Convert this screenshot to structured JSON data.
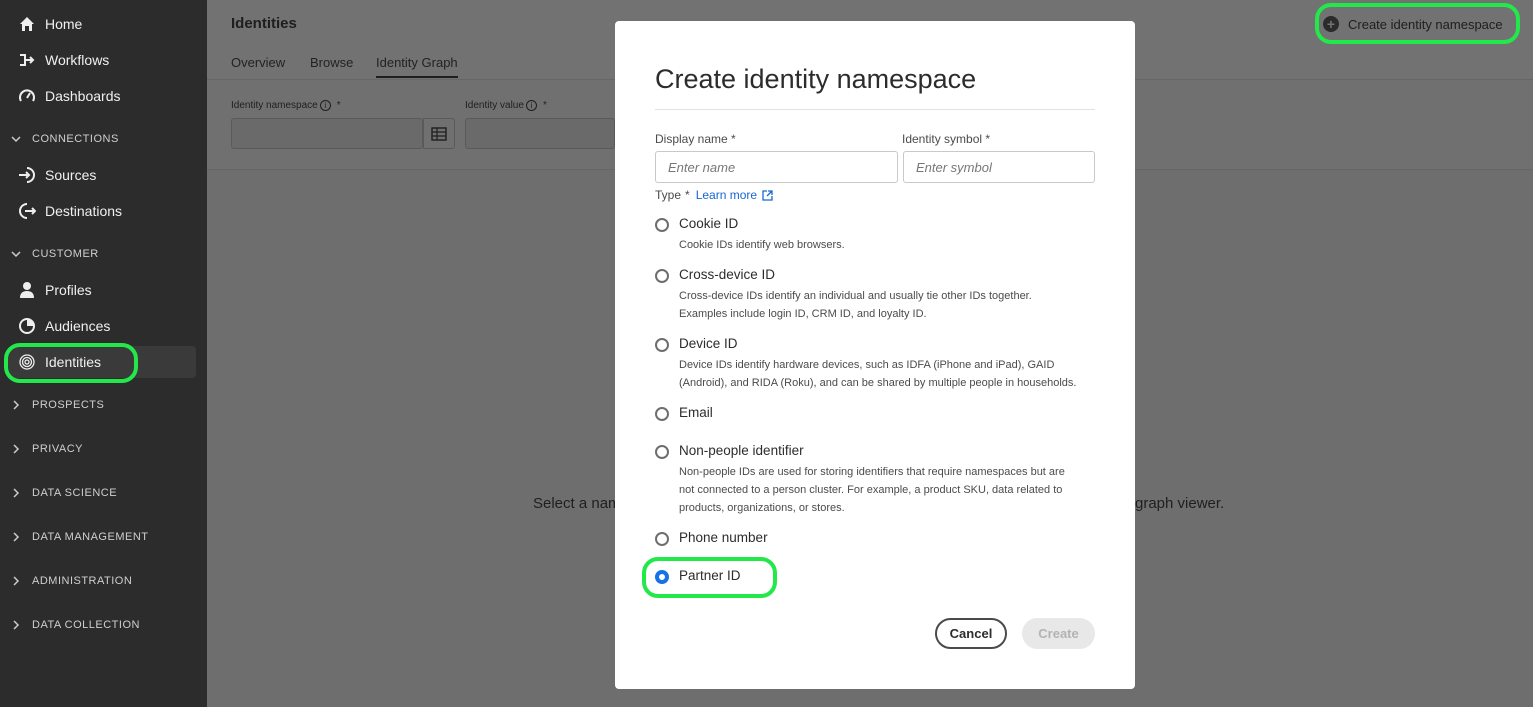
{
  "sidebar": {
    "items": [
      {
        "label": "Home",
        "icon": "home-icon"
      },
      {
        "label": "Workflows",
        "icon": "workflow-icon"
      },
      {
        "label": "Dashboards",
        "icon": "dashboard-icon"
      },
      {
        "label": "Sources",
        "icon": "source-icon"
      },
      {
        "label": "Destinations",
        "icon": "destination-icon"
      },
      {
        "label": "Profiles",
        "icon": "user-icon"
      },
      {
        "label": "Audiences",
        "icon": "audience-icon"
      },
      {
        "label": "Identities",
        "icon": "fingerprint-icon",
        "active": true
      }
    ],
    "sections": [
      "CONNECTIONS",
      "CUSTOMER",
      "PROSPECTS",
      "PRIVACY",
      "DATA SCIENCE",
      "DATA MANAGEMENT",
      "ADMINISTRATION",
      "DATA COLLECTION"
    ]
  },
  "header": {
    "title": "Identities",
    "tabs": [
      "Overview",
      "Browse",
      "Identity Graph"
    ],
    "active_tab": "Identity Graph",
    "create_button": "Create identity namespace"
  },
  "filters": {
    "namespace_label": "Identity namespace",
    "value_label": "Identity value",
    "required_mark": "*",
    "info_glyph": "i"
  },
  "main": {
    "empty_left": "Select a nam",
    "empty_right": "graph viewer."
  },
  "modal": {
    "title": "Create identity namespace",
    "display_name_label": "Display name",
    "display_name_placeholder": "Enter name",
    "identity_symbol_label": "Identity symbol",
    "identity_symbol_placeholder": "Enter symbol",
    "type_label": "Type",
    "required_mark": "*",
    "learn_more": "Learn more",
    "options": [
      {
        "title": "Cookie ID",
        "lines": [
          "Cookie IDs identify web browsers."
        ]
      },
      {
        "title": "Cross-device ID",
        "lines": [
          "Cross-device IDs identify an individual and usually tie other IDs together.",
          "Examples include login ID, CRM ID, and loyalty ID."
        ]
      },
      {
        "title": "Device ID",
        "lines": [
          "Device IDs identify hardware devices, such as IDFA (iPhone and iPad), GAID",
          "(Android), and RIDA (Roku), and can be shared by multiple people in households."
        ]
      },
      {
        "title": "Email",
        "lines": []
      },
      {
        "title": "Non-people identifier",
        "lines": [
          "Non-people IDs are used for storing identifiers that require namespaces but are",
          "not connected to a person cluster. For example, a product SKU, data related to",
          "products, organizations, or stores."
        ]
      },
      {
        "title": "Phone number",
        "lines": []
      },
      {
        "title": "Partner ID",
        "lines": [],
        "selected": true
      }
    ],
    "cancel_label": "Cancel",
    "create_label": "Create"
  },
  "colors": {
    "highlight": "#22e84a",
    "accent": "#1473e6",
    "sidebar_bg": "#2c2c2c"
  }
}
